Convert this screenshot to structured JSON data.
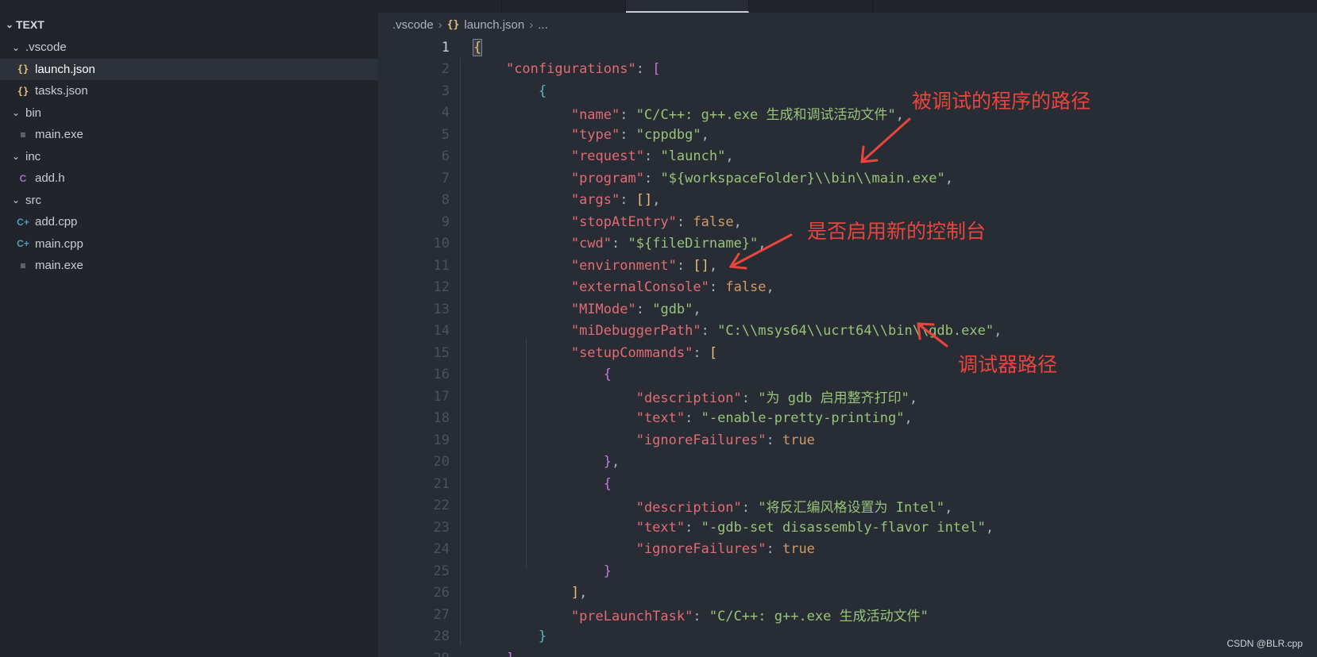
{
  "sidebar": {
    "header": "TEXT",
    "tree": [
      {
        "label": ".vscode",
        "kind": "folder",
        "depth": 0
      },
      {
        "label": "launch.json",
        "kind": "json",
        "depth": 1,
        "selected": true
      },
      {
        "label": "tasks.json",
        "kind": "json",
        "depth": 1
      },
      {
        "label": "bin",
        "kind": "folder",
        "depth": 0
      },
      {
        "label": "main.exe",
        "kind": "file",
        "depth": 1
      },
      {
        "label": "inc",
        "kind": "folder",
        "depth": 0
      },
      {
        "label": "add.h",
        "kind": "c",
        "depth": 1
      },
      {
        "label": "src",
        "kind": "folder",
        "depth": 0
      },
      {
        "label": "add.cpp",
        "kind": "cpp",
        "depth": 1
      },
      {
        "label": "main.cpp",
        "kind": "cpp",
        "depth": 1
      },
      {
        "label": "main.exe",
        "kind": "file",
        "depth": 1
      }
    ]
  },
  "icons": {
    "folder_open": "chevron-down-icon",
    "json": "json-braces-icon",
    "file": "text-file-icon",
    "c": "c-file-icon",
    "cpp": "cpp-file-icon"
  },
  "breadcrumb": {
    "folder": ".vscode",
    "file_icon": "{}",
    "file": "launch.json",
    "ellipsis": "..."
  },
  "code_lines": [
    "{",
    "    \"configurations\": [",
    "        {",
    "            \"name\": \"C/C++: g++.exe 生成和调试活动文件\",",
    "            \"type\": \"cppdbg\",",
    "            \"request\": \"launch\",",
    "            \"program\": \"${workspaceFolder}\\\\bin\\\\main.exe\",",
    "            \"args\": [],",
    "            \"stopAtEntry\": false,",
    "            \"cwd\": \"${fileDirname}\",",
    "            \"environment\": [],",
    "            \"externalConsole\": false,",
    "            \"MIMode\": \"gdb\",",
    "            \"miDebuggerPath\": \"C:\\\\msys64\\\\ucrt64\\\\bin\\\\gdb.exe\",",
    "            \"setupCommands\": [",
    "                {",
    "                    \"description\": \"为 gdb 启用整齐打印\",",
    "                    \"text\": \"-enable-pretty-printing\",",
    "                    \"ignoreFailures\": true",
    "                },",
    "                {",
    "                    \"description\": \"将反汇编风格设置为 Intel\",",
    "                    \"text\": \"-gdb-set disassembly-flavor intel\",",
    "                    \"ignoreFailures\": true",
    "                }",
    "            ],",
    "            \"preLaunchTask\": \"C/C++: g++.exe 生成活动文件\"",
    "        }",
    "    ]"
  ],
  "current_line": 1,
  "annotations": {
    "program_path": "被调试的程序的路径",
    "new_console": "是否启用新的控制台",
    "debugger_path": "调试器路径"
  },
  "watermark": "CSDN @BLR.cpp",
  "colors": {
    "annotation": "#e8453c",
    "key": "#e06c75",
    "string": "#98c379",
    "number": "#d19a66"
  }
}
